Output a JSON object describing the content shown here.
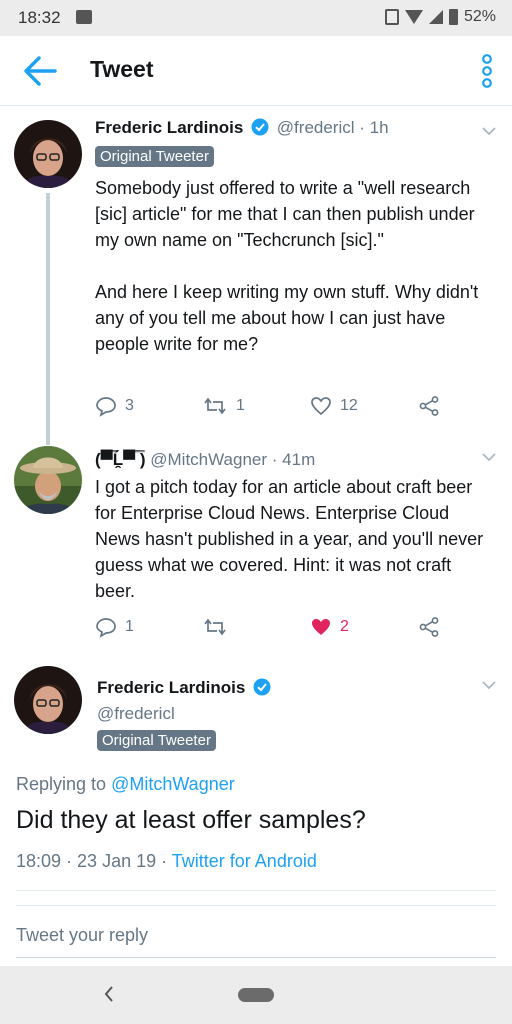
{
  "status_bar": {
    "time": "18:32",
    "battery": "52%"
  },
  "header": {
    "title": "Tweet"
  },
  "tweets": [
    {
      "name": "Frederic Lardinois",
      "handle": "@fredericl",
      "age": "· 1h",
      "badge": "Original Tweeter",
      "text": "Somebody just offered to write a \"well research [sic] article\" for me that I can then publish under my own name on \"Techcrunch [sic].\"\n\nAnd here I keep writing my own stuff. Why didn't any of you tell me about how I can just have people write for me?",
      "replies": "3",
      "retweets": "1",
      "likes": "12"
    },
    {
      "name": "(▀̿Ĺ̯▀̿ ̿)",
      "handle": "@MitchWagner",
      "age": "· 41m",
      "text": "I got a pitch today for an article about craft beer for Enterprise Cloud News. Enterprise Cloud News hasn't published in a year, and you'll never guess what we covered. Hint: it was not craft beer.",
      "replies": "1",
      "retweets": "",
      "likes": "2"
    }
  ],
  "focused": {
    "name": "Frederic Lardinois",
    "handle": "@fredericl",
    "badge": "Original Tweeter",
    "replying_label": "Replying to",
    "replying_handle": "@MitchWagner",
    "text": "Did they at least offer samples?",
    "datetime": "18:09 · 23 Jan 19 · ",
    "source": "Twitter for Android"
  },
  "reply": {
    "placeholder": "Tweet your reply"
  },
  "colors": {
    "accent": "#1da1f2",
    "like": "#e0245e",
    "muted": "#657786"
  }
}
